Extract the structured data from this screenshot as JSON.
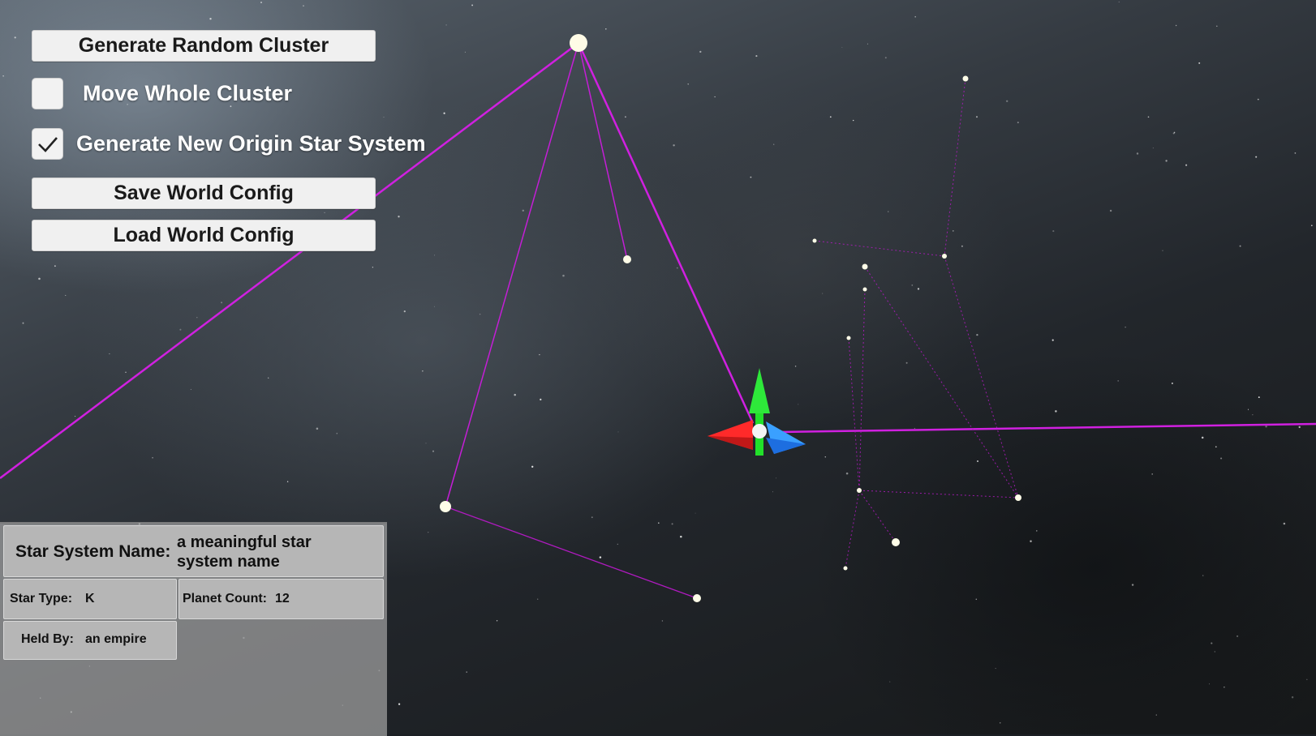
{
  "controls": {
    "generate_button": "Generate Random Cluster",
    "move_cluster": {
      "label": "Move Whole Cluster",
      "checked": false
    },
    "new_origin": {
      "label": "Generate New Origin Star System",
      "checked": true
    },
    "save_button": "Save World Config",
    "load_button": "Load World Config"
  },
  "info_panel": {
    "name_label": "Star System Name:",
    "name_value": "a meaningful star system name",
    "star_type_label": "Star Type:",
    "star_type_value": "K",
    "planet_count_label": "Planet Count:",
    "planet_count_value": "12",
    "held_by_label": "Held By:",
    "held_by_value": "an empire"
  },
  "colors": {
    "lane": "#d020e0",
    "gizmo_x": "#ff2a2a",
    "gizmo_y": "#22e02a",
    "gizmo_z": "#3aa0ff"
  }
}
